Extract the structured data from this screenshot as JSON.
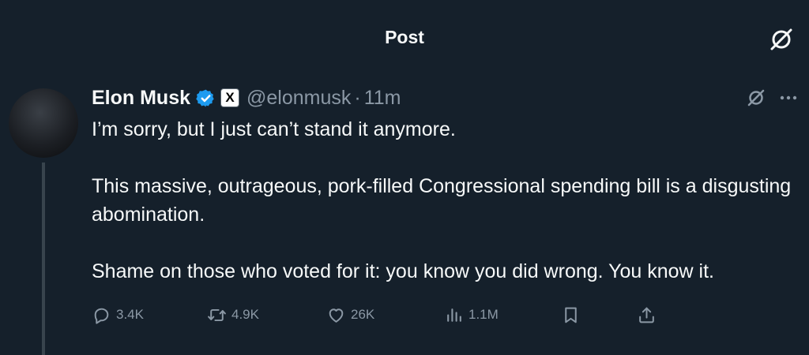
{
  "header": {
    "title": "Post"
  },
  "author": {
    "display_name": "Elon Musk",
    "handle": "@elonmusk",
    "separator": "·",
    "timestamp": "11m",
    "affiliate_badge_glyph": "X"
  },
  "tweet": {
    "paragraphs": [
      "I’m sorry, but I just can’t stand it anymore.",
      "This massive, outrageous, pork-filled Congressional spending bill is a disgusting abomination.",
      "Shame on those who voted for it: you know you did wrong. You know it."
    ]
  },
  "actions": {
    "replies": "3.4K",
    "reposts": "4.9K",
    "likes": "26K",
    "views": "1.1M"
  },
  "colors": {
    "background": "#15202b",
    "text_primary": "#f7f9f9",
    "text_secondary": "#8b98a5",
    "verified_blue": "#1d9bf0",
    "thread_line": "#38444d"
  },
  "icons": {
    "header_right": "grok-icon",
    "tweet_top_right": [
      "grok-icon",
      "more-icon"
    ],
    "actions": [
      "reply-icon",
      "repost-icon",
      "like-icon",
      "views-icon",
      "bookmark-icon",
      "share-icon"
    ]
  }
}
